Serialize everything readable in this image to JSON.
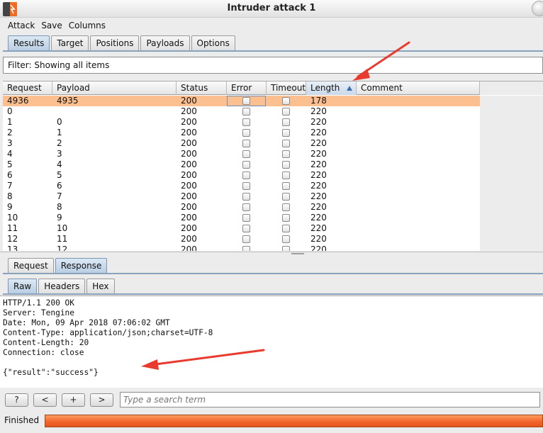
{
  "window": {
    "title": "Intruder attack 1"
  },
  "menu": [
    "Attack",
    "Save",
    "Columns"
  ],
  "main_tabs": [
    {
      "label": "Results",
      "active": true
    },
    {
      "label": "Target",
      "active": false
    },
    {
      "label": "Positions",
      "active": false
    },
    {
      "label": "Payloads",
      "active": false
    },
    {
      "label": "Options",
      "active": false
    }
  ],
  "filter": {
    "text": "Filter: Showing all items"
  },
  "table": {
    "columns": [
      "Request",
      "Payload",
      "Status",
      "Error",
      "Timeout",
      "Length",
      "Comment"
    ],
    "sorted_column": "Length",
    "rows": [
      {
        "request": "4936",
        "payload": "4935",
        "status": "200",
        "length": "178",
        "selected": true
      },
      {
        "request": "0",
        "payload": "",
        "status": "200",
        "length": "220"
      },
      {
        "request": "1",
        "payload": "0",
        "status": "200",
        "length": "220"
      },
      {
        "request": "2",
        "payload": "1",
        "status": "200",
        "length": "220"
      },
      {
        "request": "3",
        "payload": "2",
        "status": "200",
        "length": "220"
      },
      {
        "request": "4",
        "payload": "3",
        "status": "200",
        "length": "220"
      },
      {
        "request": "5",
        "payload": "4",
        "status": "200",
        "length": "220"
      },
      {
        "request": "6",
        "payload": "5",
        "status": "200",
        "length": "220"
      },
      {
        "request": "7",
        "payload": "6",
        "status": "200",
        "length": "220"
      },
      {
        "request": "8",
        "payload": "7",
        "status": "200",
        "length": "220"
      },
      {
        "request": "9",
        "payload": "8",
        "status": "200",
        "length": "220"
      },
      {
        "request": "10",
        "payload": "9",
        "status": "200",
        "length": "220"
      },
      {
        "request": "11",
        "payload": "10",
        "status": "200",
        "length": "220"
      },
      {
        "request": "12",
        "payload": "11",
        "status": "200",
        "length": "220"
      },
      {
        "request": "13",
        "payload": "12",
        "status": "200",
        "length": "220"
      }
    ]
  },
  "detail_tabs": [
    {
      "label": "Request",
      "active": false
    },
    {
      "label": "Response",
      "active": true
    }
  ],
  "view_tabs": [
    {
      "label": "Raw",
      "active": true
    },
    {
      "label": "Headers",
      "active": false
    },
    {
      "label": "Hex",
      "active": false
    }
  ],
  "response_lines": [
    "HTTP/1.1 200 OK",
    "Server: Tengine",
    "Date: Mon, 09 Apr 2018 07:06:02 GMT",
    "Content-Type: application/json;charset=UTF-8",
    "Content-Length: 20",
    "Connection: close",
    "",
    "{\"result\":\"success\"}"
  ],
  "search": {
    "help_label": "?",
    "prev_label": "<",
    "add_label": "+",
    "next_label": ">",
    "placeholder": "Type a search term"
  },
  "status": {
    "text": "Finished",
    "progress_fraction": 1.0
  },
  "colors": {
    "selected_row": "#fcbf8f",
    "progress": "#f0632a",
    "annotation_arrow": "#e83a2e",
    "active_tab": "#b8cde3"
  }
}
